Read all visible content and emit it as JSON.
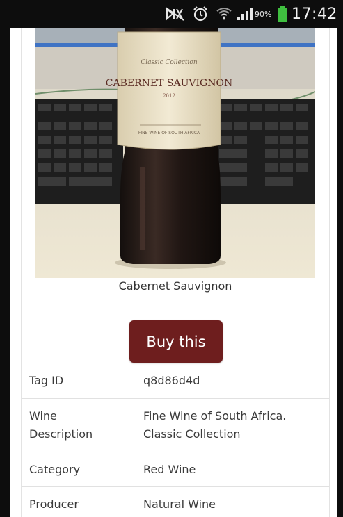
{
  "status_bar": {
    "battery_percent_text": "90%",
    "time": "17:42",
    "icons": [
      "mute-icon",
      "alarm-icon",
      "wifi-icon",
      "signal-icon",
      "battery-icon"
    ],
    "battery_level": 0.9,
    "battery_color": "#3fbf3f"
  },
  "product": {
    "photo_label_line1": "CABERNET SAUVIGNON",
    "photo_label_year": "2012",
    "caption": "Cabernet Sauvignon"
  },
  "buy_button": {
    "label": "Buy this",
    "color": "#6e1e1e"
  },
  "details": {
    "tag_id": {
      "label": "Tag ID",
      "value": "q8d86d4d"
    },
    "description": {
      "label_line1": "Wine",
      "label_line2": "Description",
      "value_line1": "Fine Wine of South Africa.",
      "value_line2": "Classic Collection"
    },
    "category": {
      "label": "Category",
      "value": "Red Wine"
    },
    "producer": {
      "label": "Producer",
      "value": "Natural Wine"
    }
  }
}
